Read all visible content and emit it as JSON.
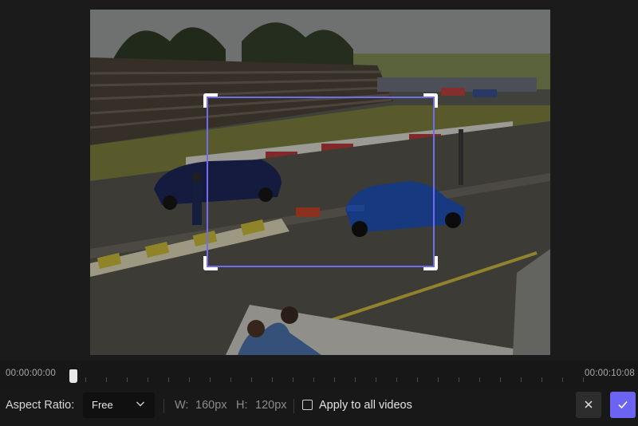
{
  "timeline": {
    "start_time": "00:00:00:00",
    "end_time": "00:00:10:08"
  },
  "toolbar": {
    "aspect_label": "Aspect Ratio:",
    "aspect_value": "Free",
    "width_label": "W:",
    "width_value": "160px",
    "height_label": "H:",
    "height_value": "120px",
    "apply_label": "Apply to all videos",
    "apply_checked": false
  },
  "icons": {
    "aspect_dropdown": "chevron-down-icon",
    "cancel": "close-icon",
    "confirm": "check-icon"
  },
  "colors": {
    "accent": "#6c63f2",
    "crop_border": "#6f6cf0",
    "background": "#181818"
  }
}
